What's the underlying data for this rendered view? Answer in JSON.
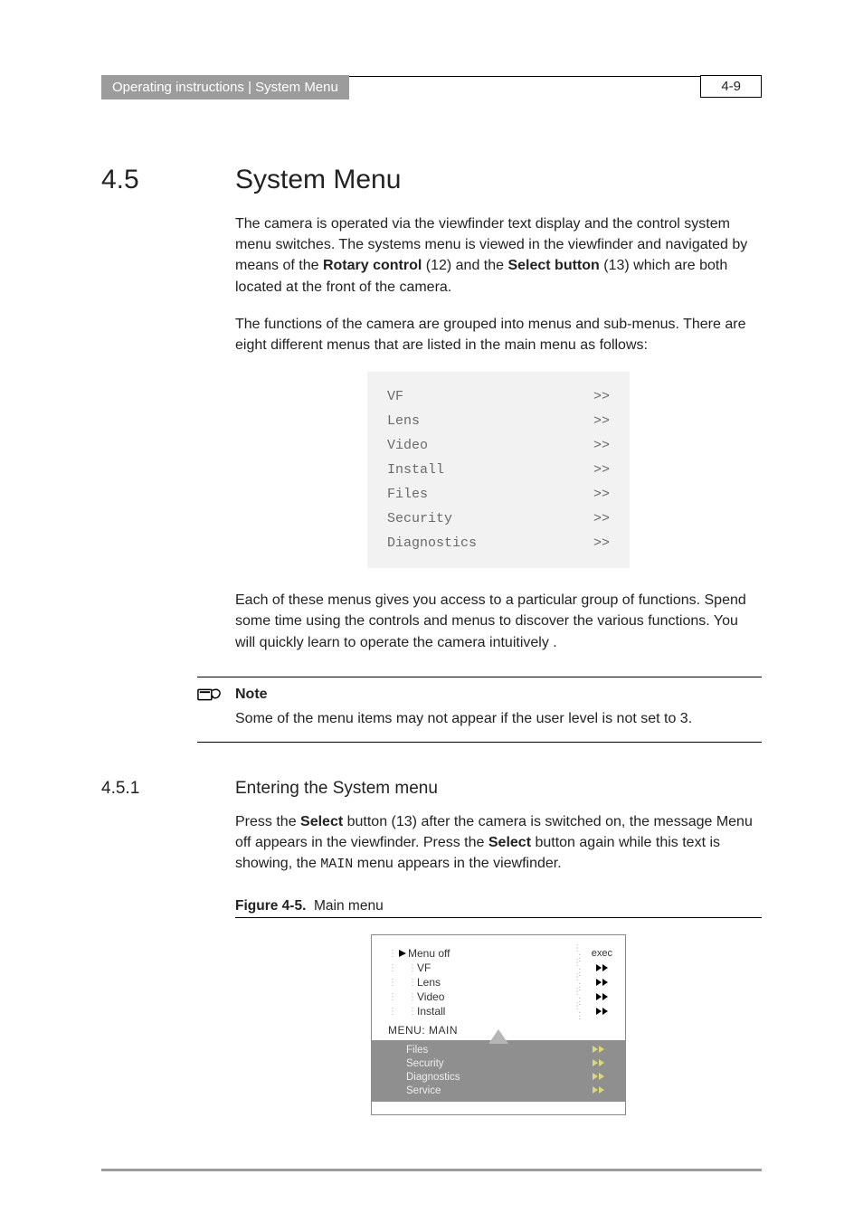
{
  "header": {
    "breadcrumb": "Operating instructions | System Menu",
    "page_number": "4-9"
  },
  "section": {
    "number": "4.5",
    "title": "System Menu",
    "para1_pre": "The camera is operated via the viewfinder text display and the control system menu switches. The systems menu is viewed in the viewfinder and navigated by means of the ",
    "rotary": "Rotary control",
    "para1_mid": " (12) and the ",
    "selectbtn": "Select button",
    "para1_post": " (13) which are both located at the front of the camera.",
    "para2": "The functions of the camera are grouped into menus and sub-menus. There are eight different menus that are listed in the main menu as follows:",
    "menu": [
      {
        "label": "VF",
        "arrow": ">>"
      },
      {
        "label": "Lens",
        "arrow": ">>"
      },
      {
        "label": "Video",
        "arrow": ">>"
      },
      {
        "label": "Install",
        "arrow": ">>"
      },
      {
        "label": "Files",
        "arrow": ">>"
      },
      {
        "label": "Security",
        "arrow": ">>"
      },
      {
        "label": "Diagnostics",
        "arrow": ">>"
      }
    ],
    "para3": "Each of these menus gives you access to a particular group of functions. Spend some time using the controls and menus to discover the various functions. You will quickly learn to operate the camera intuitively ."
  },
  "note": {
    "title": "Note",
    "text": "Some of the menu items may not appear if the user level is not set to 3."
  },
  "subsection": {
    "number": "4.5.1",
    "title": "Entering the System menu",
    "para_pre": "Press the ",
    "select1": "Select",
    "para_mid1": " button (13) after the camera is switched on, the message Menu off appears in the viewfinder. Press the ",
    "select2": "Select",
    "para_mid2": " button again while this text is showing, the ",
    "main_mono": "MAIN",
    "para_post": " menu appears in the viewfinder."
  },
  "figure": {
    "label": "Figure 4-5.",
    "caption": "Main menu",
    "upper": [
      "Menu off",
      "VF",
      "Lens",
      "Video",
      "Install"
    ],
    "exec": "exec",
    "menu_label": "MENU:  MAIN",
    "lower": [
      "Files",
      "Security",
      "Diagnostics",
      "Service"
    ]
  }
}
